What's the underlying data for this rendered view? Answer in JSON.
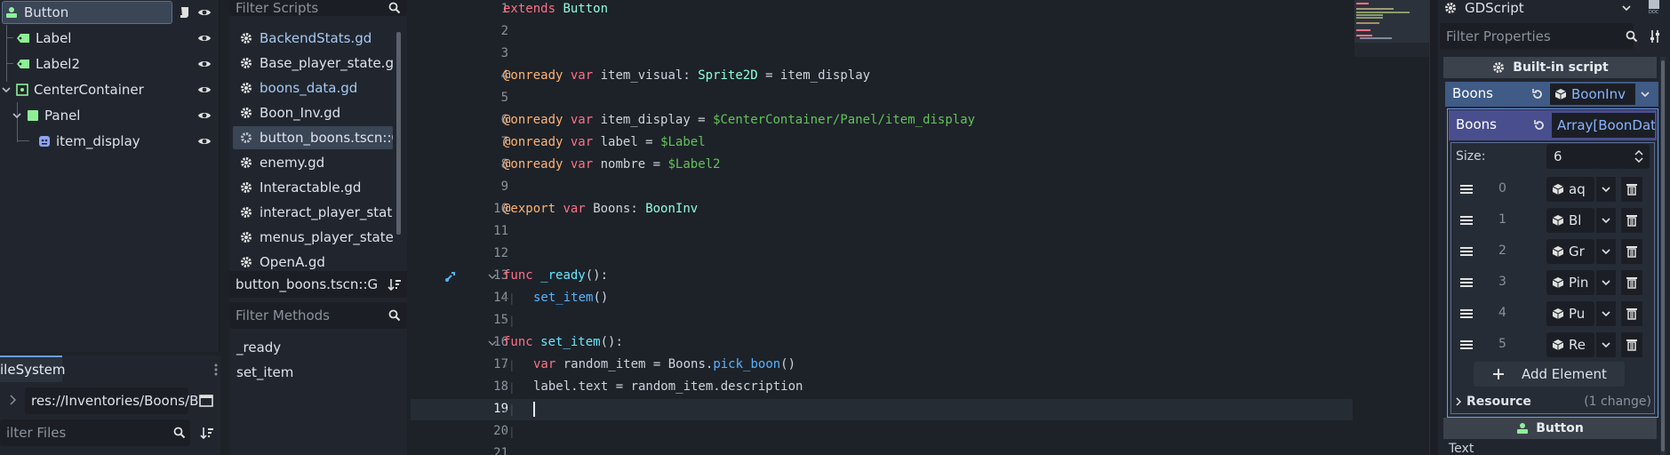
{
  "scene_tree": {
    "nodes": [
      {
        "label": "Button",
        "selected": true
      },
      {
        "label": "Label"
      },
      {
        "label": "Label2"
      },
      {
        "label": "CenterContainer"
      },
      {
        "label": "Panel"
      },
      {
        "label": "item_display"
      }
    ]
  },
  "filesystem": {
    "tab_label": "ileSystem",
    "path_value": "res://Inventories/Boons/B",
    "filter_placeholder": "ilter Files"
  },
  "scripts_panel": {
    "filter_placeholder": "Filter Scripts",
    "items": [
      {
        "label": "BackendStats.gd",
        "blue": true
      },
      {
        "label": "Base_player_state.gd"
      },
      {
        "label": "boons_data.gd",
        "blue": true
      },
      {
        "label": "Boon_Inv.gd"
      },
      {
        "label": "button_boons.tscn::G...",
        "selected": true
      },
      {
        "label": "enemy.gd"
      },
      {
        "label": "Interactable.gd"
      },
      {
        "label": "interact_player_state...."
      },
      {
        "label": "menus_player_state.gd"
      },
      {
        "label": "OpenA.gd"
      }
    ],
    "current_script": "button_boons.tscn::GDSc",
    "methods_placeholder": "Filter Methods",
    "methods": [
      "_ready",
      "set_item"
    ]
  },
  "editor": {
    "line_numbers": [
      "1",
      "2",
      "3",
      "4",
      "5",
      "6",
      "7",
      "8",
      "9",
      "10",
      "11",
      "12",
      "13",
      "14",
      "15",
      "16",
      "17",
      "18",
      "19",
      "20",
      "21"
    ],
    "code": {
      "l1_kw": "extends",
      "l1_ty": "Button",
      "l4_an": "@onready",
      "l4_kw": "var",
      "l4_a": "item_visual:",
      "l4_ty": "Sprite2D",
      "l4_b": "= item_display",
      "l6_an": "@onready",
      "l6_kw": "var",
      "l6_a": "item_display =",
      "l6_np": "$CenterContainer/Panel/item_display",
      "l7_an": "@onready",
      "l7_kw": "var",
      "l7_a": "label =",
      "l7_np": "$Label",
      "l8_an": "@onready",
      "l8_kw": "var",
      "l8_a": "nombre =",
      "l8_np": "$Label2",
      "l10_an": "@export",
      "l10_kw": "var",
      "l10_a": "Boons:",
      "l10_ty": "BoonInv",
      "l13_kw": "func",
      "l13_fn": "_ready",
      "l13_a": "():",
      "l14_fn": "set_item",
      "l14_a": "()",
      "l16_kw": "func",
      "l16_fn": "set_item",
      "l16_a": "():",
      "l17_kw": "var",
      "l17_a": "random_item = Boons.",
      "l17_fn": "pick_boon",
      "l17_b": "()",
      "l18_a": "label.text = random_item.description"
    }
  },
  "inspector": {
    "script_type": "GDScript",
    "filter_placeholder": "Filter Properties",
    "section_title": "Built-in script",
    "boons_label": "Boons",
    "boons_value": "BoonInv",
    "array_label": "Boons",
    "array_type": "Array[BoonDat",
    "size_label": "Size:",
    "size_value": "6",
    "elements": [
      {
        "index": "0",
        "value": "aq"
      },
      {
        "index": "1",
        "value": "Bl"
      },
      {
        "index": "2",
        "value": "Gr"
      },
      {
        "index": "3",
        "value": "Pin"
      },
      {
        "index": "4",
        "value": "Pu"
      },
      {
        "index": "5",
        "value": "Re"
      }
    ],
    "add_element": "Add Element",
    "resource_label": "Resource",
    "resource_changes": "(1 change)",
    "button_section": "Button",
    "text_label": "Text"
  },
  "colors": {
    "accent": "#699ce8",
    "panel": "#21262e",
    "editor_bg": "#1d2229",
    "node_green": "#8eef97",
    "node_blue": "#8da5f3"
  }
}
